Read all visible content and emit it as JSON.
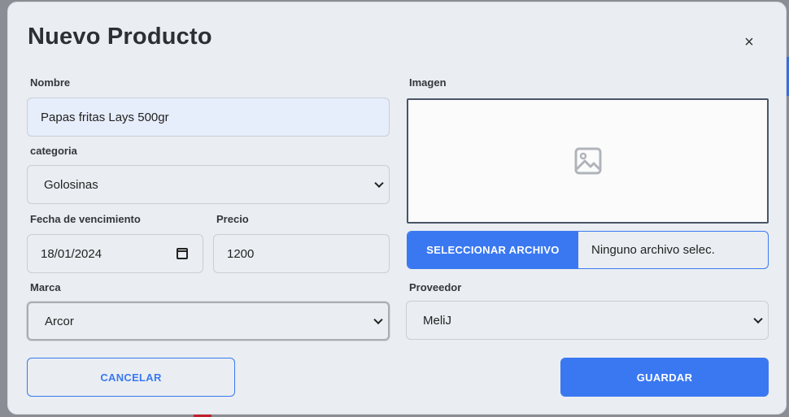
{
  "modal": {
    "title": "Nuevo Producto",
    "close_label": "×"
  },
  "form": {
    "nombre": {
      "label": "Nombre",
      "value": "Papas fritas Lays 500gr"
    },
    "categoria": {
      "label": "categoria",
      "selected": "Golosinas"
    },
    "fecha": {
      "label": "Fecha de vencimiento",
      "value": "18/01/2024"
    },
    "precio": {
      "label": "Precio",
      "value": "1200"
    },
    "marca": {
      "label": "Marca",
      "selected": "Arcor"
    },
    "imagen": {
      "label": "Imagen",
      "button": "SELECCIONAR ARCHIVO",
      "file_status": "Ninguno archivo selec."
    },
    "proveedor": {
      "label": "Proveedor",
      "selected": "MeliJ"
    }
  },
  "actions": {
    "cancel": "CANCELAR",
    "save": "GUARDAR"
  },
  "colors": {
    "accent": "#3a78f2",
    "modal_bg": "#eaeef2",
    "title": "#2c2f33"
  },
  "icons": {
    "close": "close-icon",
    "image_placeholder": "image-icon",
    "calendar": "calendar-icon",
    "select": "chevron-down-icon"
  }
}
